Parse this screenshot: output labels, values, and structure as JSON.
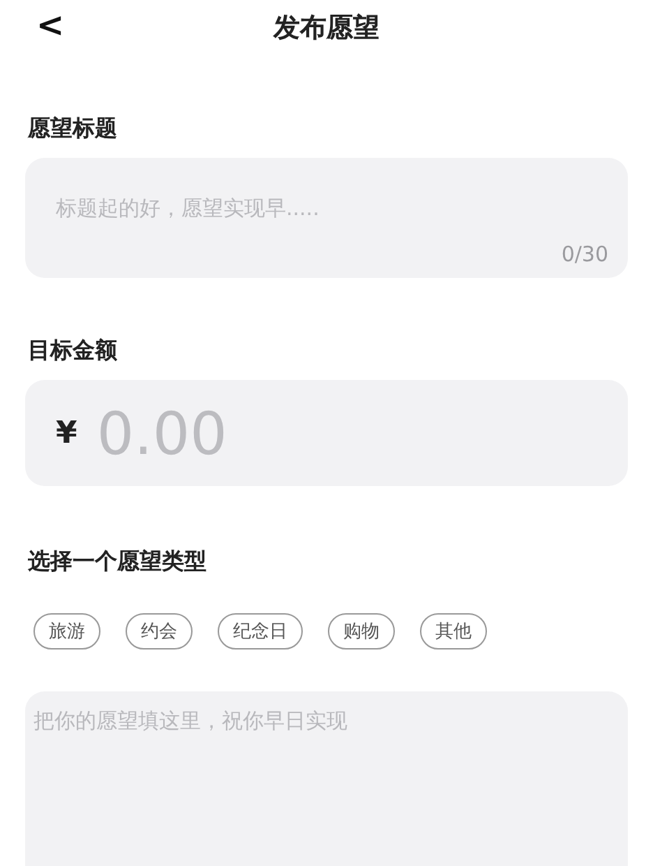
{
  "header": {
    "back": "<",
    "title": "发布愿望"
  },
  "wish_title": {
    "label": "愿望标题",
    "placeholder": "标题起的好，愿望实现早.....",
    "counter": "0/30"
  },
  "target_amount": {
    "label": "目标金额",
    "currency": "¥",
    "placeholder": "0.00"
  },
  "wish_type": {
    "label": "选择一个愿望类型",
    "options": [
      {
        "label": "旅游",
        "selected": false
      },
      {
        "label": "约会",
        "selected": false
      },
      {
        "label": "纪念日",
        "selected": false
      },
      {
        "label": "购物",
        "selected": false
      },
      {
        "label": "其他",
        "selected": false
      }
    ]
  },
  "description": {
    "placeholder": "把你的愿望填这里，祝你早日实现"
  }
}
